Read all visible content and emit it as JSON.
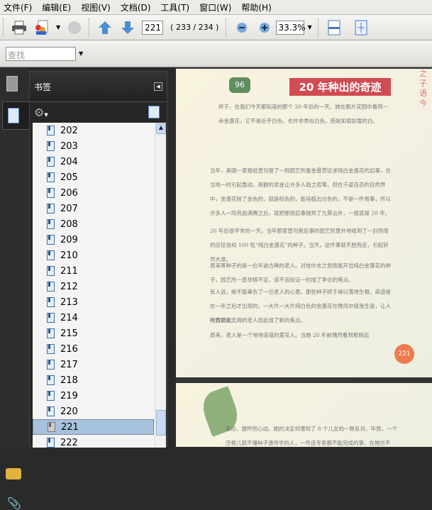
{
  "menu": [
    "文件(F)",
    "编辑(E)",
    "视图(V)",
    "文档(D)",
    "工具(T)",
    "窗口(W)",
    "帮助(H)"
  ],
  "toolbar": {
    "current_page": "221",
    "page_count": "( 233 / 234 )",
    "zoom": "33.3%"
  },
  "find": {
    "placeholder": "查找"
  },
  "bookmarks": {
    "title": "书签",
    "items": [
      "202",
      "203",
      "204",
      "205",
      "206",
      "207",
      "208",
      "209",
      "210",
      "211",
      "212",
      "213",
      "214",
      "215",
      "216",
      "217",
      "218",
      "219",
      "220",
      "221",
      "222"
    ],
    "selected": "221"
  },
  "document": {
    "page1": {
      "title": "20 年种出的奇迹",
      "side_text": "之子语今",
      "mug": "96",
      "page_number": "221",
      "paragraphs": [
        "终于，在我们今天都知道的那个 20 年后的一天，她在那片花园中看到一朵金盏花，它不是近乎白色，也并非类似白色，而是如银如雪的白。",
        "当年，美国一家报纸曾刊登了一则园艺所重金悬赏征求纯白金盏花的启事，在当地一时引起轰动。高额的奖金让许多人趋之若鹜，但在千姿百态的自然界中，金盏花除了金色的，就是棕色的，能培植出白色的，不是一件易事，所以许多人一阵热血沸腾之后，就把那则启事抛到了九霄云外，一晃就是 20 年。",
        "20 年后很平常的一天，当年那家曾刊登启事的园艺所意外地收到了一封热情的应征信和 100 粒“纯白金盏花”的种子。当天，这件事就不胫而走，引起轩然大波。",
        "原来寄种子的是一位年逾古稀的老人。对信中言之凿凿能开出纯白金盏花的种子，园艺所一直举棋不定，该不该验证一时成了争论的焦点。",
        "有人说，绝不能辜负了一位老人的心意。那些种子终于得以落地生根。奇迹是在一年之后才出现的，一大片一大片纯白色的金盏花在微风中摇曳生姿，让人瞠目结舌。",
        "一直默默无闻的老人因此成了新的焦点。",
        "原来，老人是一个地地道道的爱花人。当她 20 年前偶然看到那则启"
      ]
    },
    "page2": {
      "paragraphs": [
        "事后，便怦然心动。她的决定却遭到了 8 个儿女的一致反对。毕竟，一个",
        "压根儿就不懂种子遗传学的人，一件连专家都不能完成的事，在她岂不"
      ]
    }
  }
}
